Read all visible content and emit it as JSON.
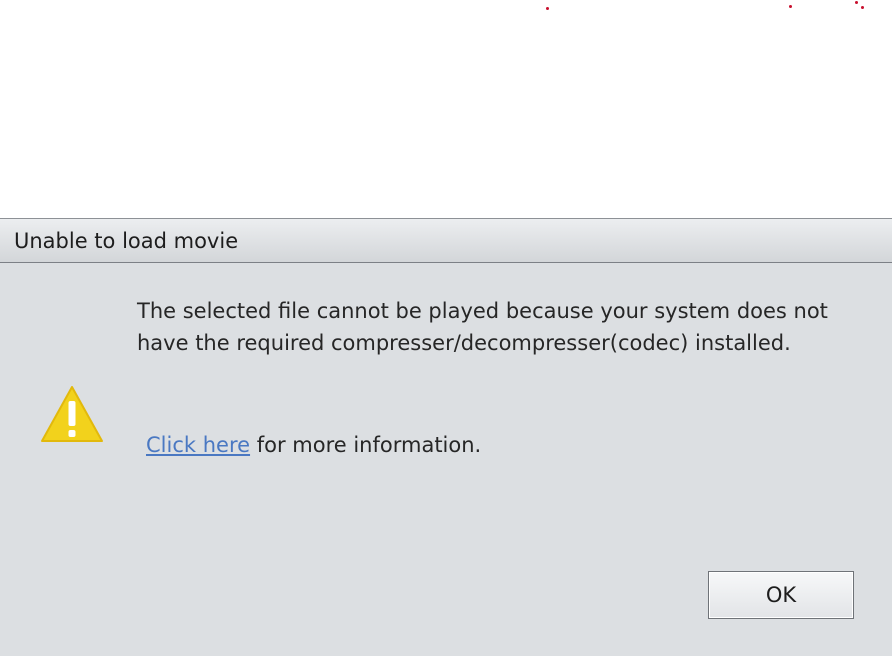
{
  "dialog": {
    "title": "Unable to load movie",
    "icon": "warning-icon",
    "message": "The selected file cannot be played because your system does not have the required compresser/decompresser(codec) installed.",
    "link_text": "Click here",
    "link_suffix": " for more information.",
    "ok_label": "OK"
  },
  "colors": {
    "dialog_background": "#dcdfe2",
    "link": "#4a78c2",
    "warning_fill": "#f2d21c",
    "background_dots": "#c8102e"
  }
}
